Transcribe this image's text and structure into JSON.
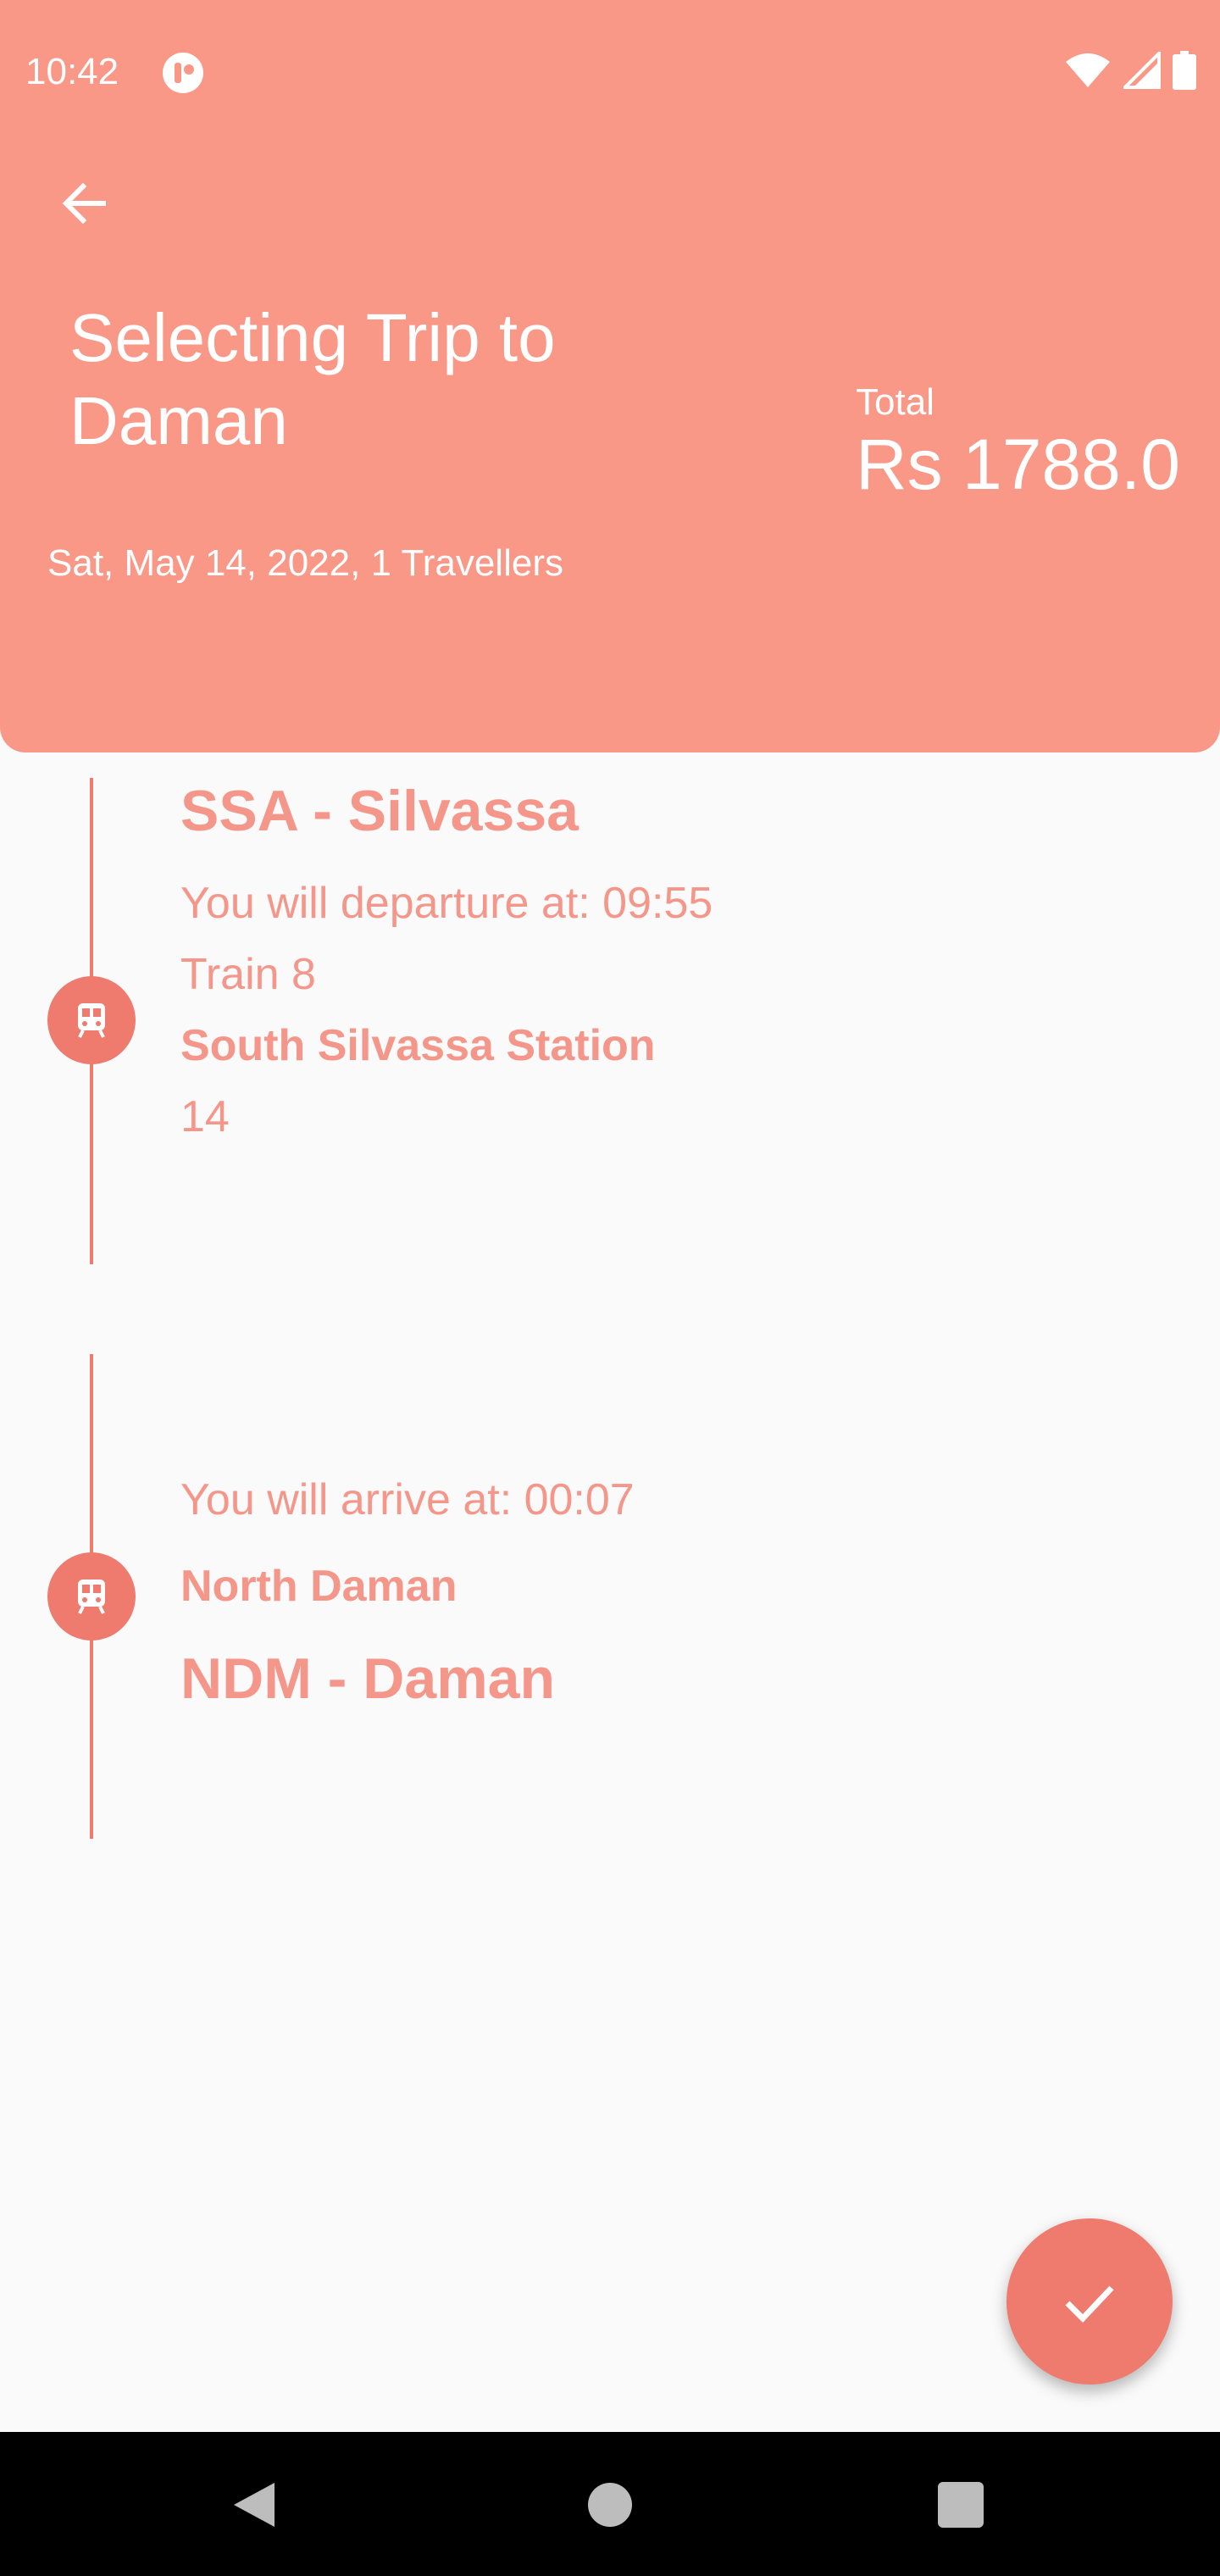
{
  "status_bar": {
    "time": "10:42",
    "icons": [
      "app-notification-icon",
      "wifi-icon",
      "cellular-signal-icon",
      "battery-icon"
    ]
  },
  "header": {
    "back_icon": "arrow-left-icon",
    "title": "Selecting Trip to Daman",
    "subtitle": "Sat, May 14, 2022, 1 Travellers",
    "total_label": "Total",
    "total_value": "Rs 1788.0"
  },
  "departure": {
    "code": "SSA - Silvassa",
    "time_text": "You will departure at: 09:55",
    "train": "Train 8",
    "station": "South Silvassa Station",
    "platform": "14",
    "icon": "train-icon"
  },
  "arrival": {
    "time_text": "You will arrive at: 00:07",
    "station": "North Daman",
    "code": "NDM - Daman",
    "icon": "train-icon"
  },
  "fab": {
    "icon": "check-icon"
  },
  "nav": {
    "icons": [
      "nav-back-icon",
      "nav-home-icon",
      "nav-recents-icon"
    ]
  },
  "colors": {
    "header_bg": "#F99887",
    "accent": "#EE7B6D",
    "text_accent": "#F4978A",
    "background": "#FAFAFA"
  }
}
